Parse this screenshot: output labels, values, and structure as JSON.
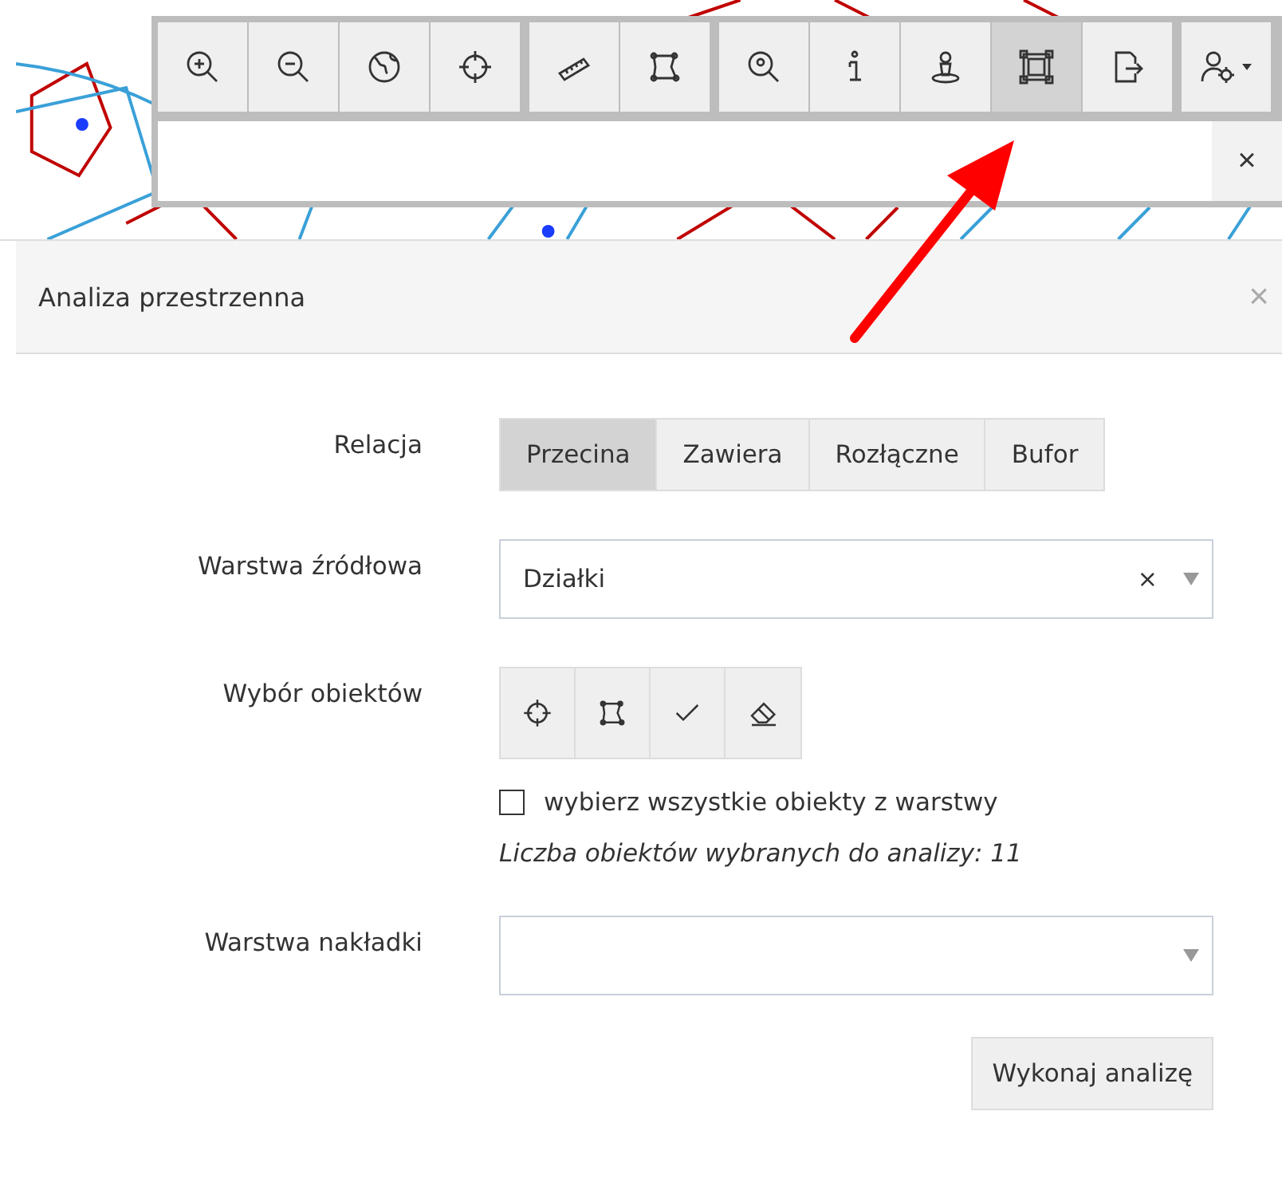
{
  "toolbar": {
    "groups": [
      {
        "buttons": [
          {
            "kind": "zoomin",
            "selected": false
          },
          {
            "kind": "zoomout",
            "selected": false
          },
          {
            "kind": "globe",
            "selected": false
          },
          {
            "kind": "crosshair",
            "selected": false
          }
        ]
      },
      {
        "buttons": [
          {
            "kind": "ruler",
            "selected": false
          },
          {
            "kind": "polygon",
            "selected": false
          }
        ]
      },
      {
        "buttons": [
          {
            "kind": "searchpin",
            "selected": false
          },
          {
            "kind": "info",
            "selected": false
          },
          {
            "kind": "person",
            "selected": false
          },
          {
            "kind": "frame",
            "selected": true
          },
          {
            "kind": "export",
            "selected": false
          }
        ]
      },
      {
        "buttons": [
          {
            "kind": "user",
            "selected": false
          }
        ]
      }
    ]
  },
  "search": {
    "clear": "×"
  },
  "panel": {
    "title": "Analiza przestrzenna",
    "close": "×",
    "relation": {
      "label": "Relacja",
      "options": [
        {
          "label": "Przecina",
          "selected": true
        },
        {
          "label": "Zawiera",
          "selected": false
        },
        {
          "label": "Rozłączne",
          "selected": false
        },
        {
          "label": "Bufor",
          "selected": false
        }
      ]
    },
    "source_layer": {
      "label": "Warstwa źródłowa",
      "value": "Działki",
      "clear": "×"
    },
    "selection": {
      "label": "Wybór obiektów",
      "tools": [
        {
          "kind": "crosshair"
        },
        {
          "kind": "polygon"
        },
        {
          "kind": "check"
        },
        {
          "kind": "eraser"
        }
      ],
      "select_all": {
        "label": "wybierz wszystkie obiekty z warstwy",
        "checked": false
      },
      "count": "Liczba obiektów wybranych do analizy: 11"
    },
    "overlay_layer": {
      "label": "Warstwa nakładki"
    },
    "run_button": "Wykonaj analizę"
  }
}
